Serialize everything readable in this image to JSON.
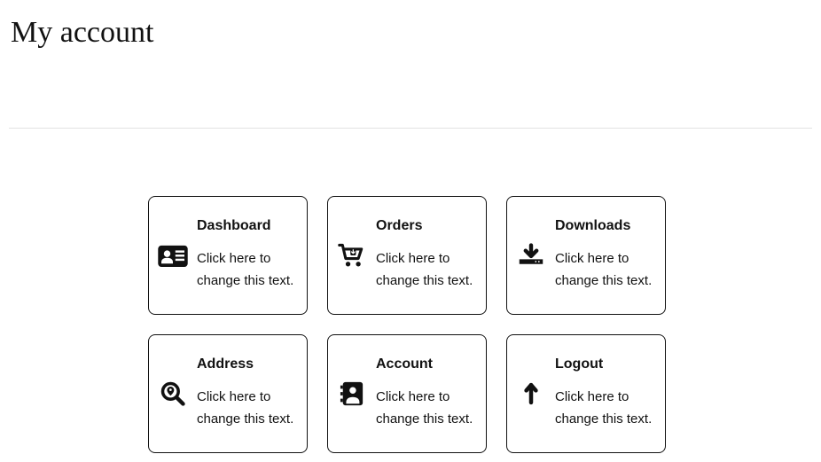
{
  "header": {
    "title": "My account"
  },
  "cards": [
    {
      "title": "Dashboard",
      "desc": "Click here to change this text."
    },
    {
      "title": "Orders",
      "desc": "Click here to change this text."
    },
    {
      "title": "Downloads",
      "desc": "Click here to change this text."
    },
    {
      "title": "Address",
      "desc": "Click here to change this text."
    },
    {
      "title": "Account",
      "desc": "Click here to change this text."
    },
    {
      "title": "Logout",
      "desc": "Click here to change this text."
    }
  ]
}
